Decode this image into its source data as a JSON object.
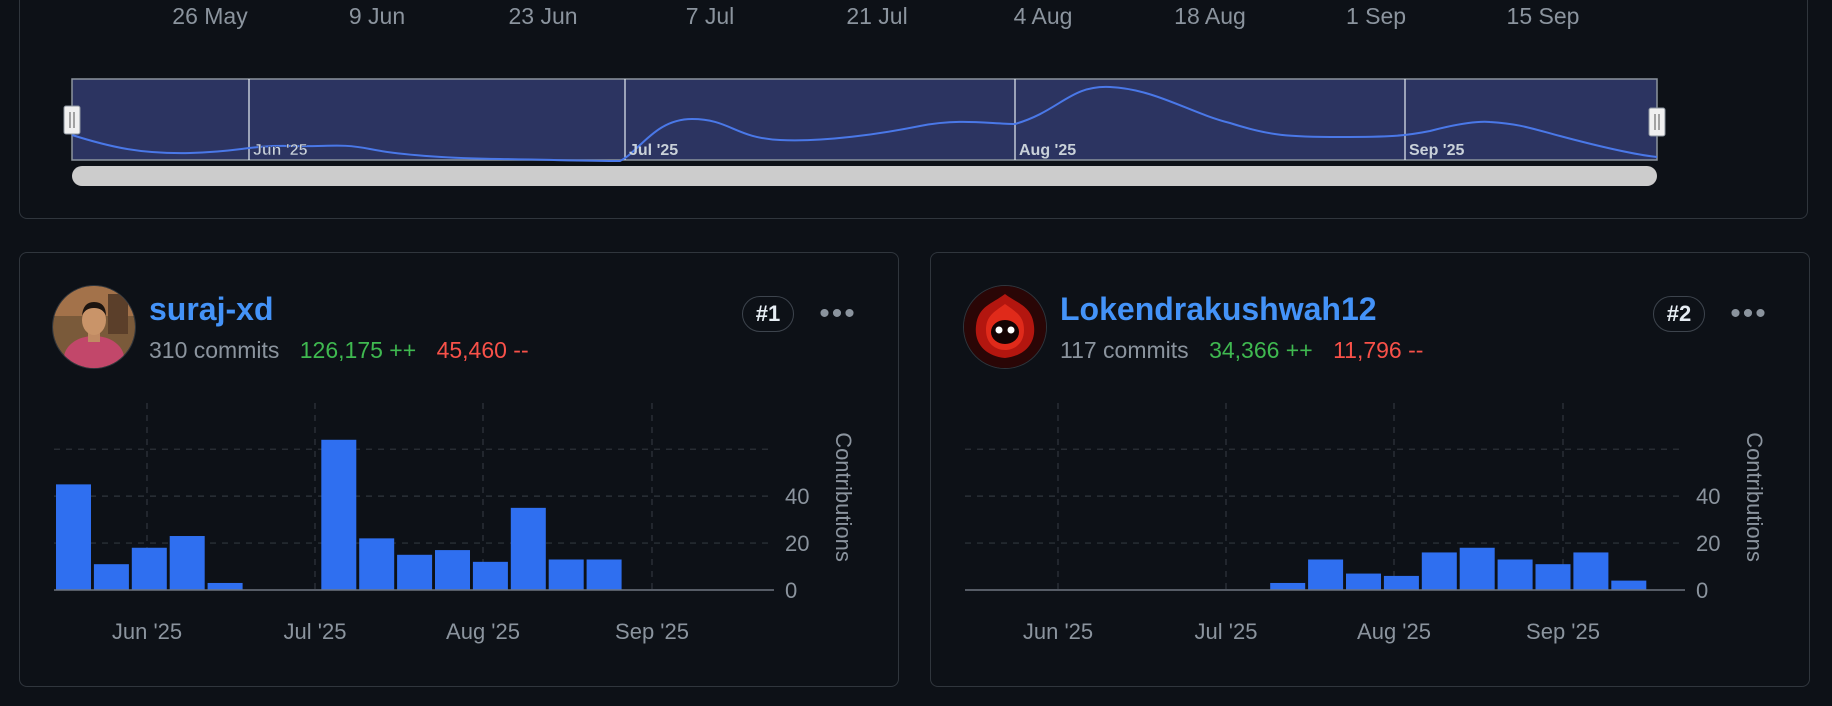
{
  "overview": {
    "date_ticks": [
      "26 May",
      "9 Jun",
      "23 Jun",
      "7 Jul",
      "21 Jul",
      "4 Aug",
      "18 Aug",
      "1 Sep",
      "15 Sep"
    ],
    "brush_labels": [
      "Jun '25",
      "Jul '25",
      "Aug '25",
      "Sep '25"
    ]
  },
  "contributors": [
    {
      "name": "suraj-xd",
      "commits": "310 commits",
      "additions": "126,175 ++",
      "deletions": "45,460 --",
      "rank": "#1",
      "menu": "•••",
      "avatar": "person-avatar"
    },
    {
      "name": "Lokendrakushwah12",
      "commits": "117 commits",
      "additions": "34,366 ++",
      "deletions": "11,796 --",
      "rank": "#2",
      "menu": "•••",
      "avatar": "red-creature-avatar"
    }
  ],
  "chart_data": [
    {
      "type": "bar",
      "series": [
        {
          "values": [
            45,
            11,
            18,
            23,
            3,
            0,
            0,
            64,
            22,
            15,
            17,
            12,
            35,
            13,
            13,
            0,
            0,
            0,
            0
          ]
        }
      ],
      "x_tick_labels": [
        "Jun '25",
        "Jul '25",
        "Aug '25",
        "Sep '25"
      ],
      "y_ticks": [
        0,
        20,
        40
      ],
      "ylabel": "Contributions",
      "ylim": [
        0,
        72
      ],
      "grid": true,
      "bar_color": "#2f6ff0"
    },
    {
      "type": "bar",
      "series": [
        {
          "values": [
            0,
            0,
            0,
            0,
            0,
            0,
            0,
            0,
            3,
            13,
            7,
            6,
            16,
            18,
            13,
            11,
            16,
            4,
            0
          ]
        }
      ],
      "x_tick_labels": [
        "Jun '25",
        "Jul '25",
        "Aug '25",
        "Sep '25"
      ],
      "y_ticks": [
        0,
        20,
        40
      ],
      "ylabel": "Contributions",
      "ylim": [
        0,
        72
      ],
      "grid": true,
      "bar_color": "#2f6ff0"
    }
  ],
  "colors": {
    "accent": "#4493f8",
    "additions": "#3fb950",
    "deletions": "#f85149",
    "bar": "#2f6ff0",
    "brush_fill": "#2c3461",
    "line": "#4a78e8"
  }
}
